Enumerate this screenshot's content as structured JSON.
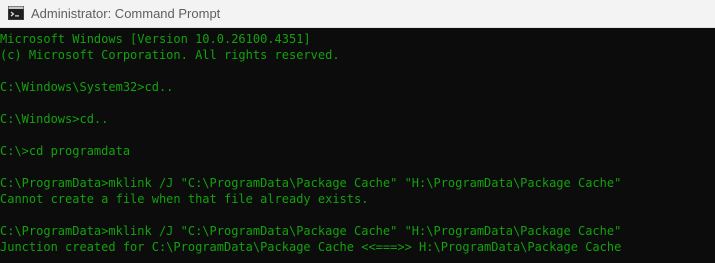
{
  "window": {
    "title": "Administrator: Command Prompt",
    "icon": "cmd-icon"
  },
  "colors": {
    "console_background": "#0c0c0c",
    "console_text": "#13a10e",
    "titlebar_background": "#f3f3f3",
    "title_text": "#5f5f5f"
  },
  "console": {
    "lines": [
      "Microsoft Windows [Version 10.0.26100.4351]",
      "(c) Microsoft Corporation. All rights reserved.",
      "",
      "C:\\Windows\\System32>cd..",
      "",
      "C:\\Windows>cd..",
      "",
      "C:\\>cd programdata",
      "",
      "C:\\ProgramData>mklink /J \"C:\\ProgramData\\Package Cache\" \"H:\\ProgramData\\Package Cache\"",
      "Cannot create a file when that file already exists.",
      "",
      "C:\\ProgramData>mklink /J \"C:\\ProgramData\\Package Cache\" \"H:\\ProgramData\\Package Cache\"",
      "Junction created for C:\\ProgramData\\Package Cache <<===>> H:\\ProgramData\\Package Cache"
    ]
  }
}
